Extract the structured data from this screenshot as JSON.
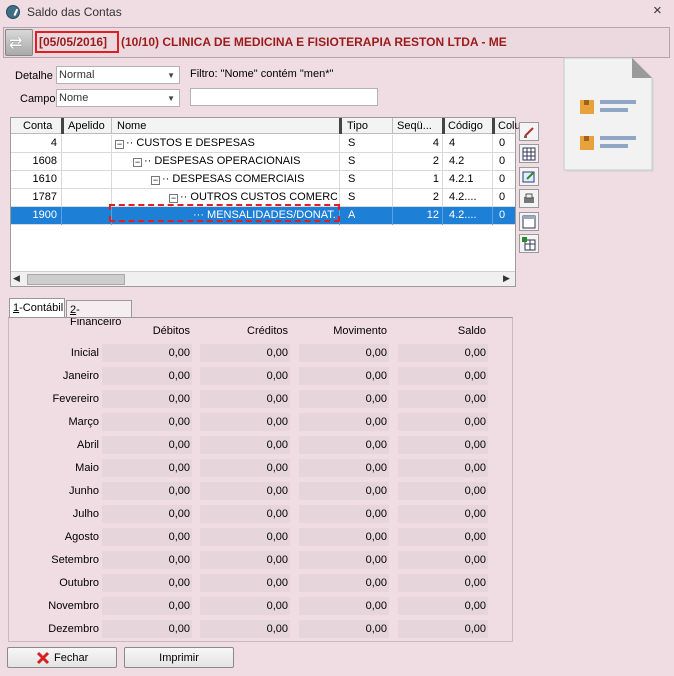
{
  "window": {
    "title": "Saldo das Contas",
    "close_glyph": "×"
  },
  "header": {
    "swap_icon": "swap-arrows-icon",
    "date": "[05/05/2016]",
    "company": "(10/10) CLINICA DE MEDICINA E FISIOTERAPIA RESTON LTDA - ME"
  },
  "filters": {
    "detalhe_label": "Detalhe",
    "detalhe_value": "Normal",
    "filtro_text": "Filtro: \"Nome\" contém \"men*\"",
    "campo_label": "Campo",
    "campo_value": "Nome",
    "search_value": ""
  },
  "grid": {
    "columns": [
      "Conta",
      "Apelido",
      "Nome",
      "Tipo",
      "Seqü...",
      "Código",
      "Colu"
    ],
    "rows": [
      {
        "conta": "4",
        "apelido": "",
        "nome": "CUSTOS E DESPESAS",
        "tipo": "S",
        "seq": "4",
        "codigo": "4",
        "col": "0"
      },
      {
        "conta": "1608",
        "apelido": "",
        "nome": "DESPESAS OPERACIONAIS",
        "tipo": "S",
        "seq": "2",
        "codigo": "4.2",
        "col": "0"
      },
      {
        "conta": "1610",
        "apelido": "",
        "nome": "DESPESAS COMERCIAIS",
        "tipo": "S",
        "seq": "1",
        "codigo": "4.2.1",
        "col": "0"
      },
      {
        "conta": "1787",
        "apelido": "",
        "nome": "OUTROS CUSTOS COMERC...",
        "tipo": "S",
        "seq": "2",
        "codigo": "4.2....",
        "col": "0"
      },
      {
        "conta": "1900",
        "apelido": "",
        "nome": "MENSALIDADES/DONAT...",
        "tipo": "A",
        "seq": "12",
        "codigo": "4.2....",
        "col": "0"
      }
    ]
  },
  "tabs": {
    "contabil_key": "1",
    "contabil": "-Contábil",
    "financeiro_key": "2",
    "financeiro": "-Financeiro"
  },
  "balances": {
    "headers": [
      "Débitos",
      "Créditos",
      "Movimento",
      "Saldo"
    ],
    "months": [
      {
        "name": "Inicial",
        "values": [
          "0,00",
          "0,00",
          "0,00",
          "0,00"
        ]
      },
      {
        "name": "Janeiro",
        "values": [
          "0,00",
          "0,00",
          "0,00",
          "0,00"
        ]
      },
      {
        "name": "Fevereiro",
        "values": [
          "0,00",
          "0,00",
          "0,00",
          "0,00"
        ]
      },
      {
        "name": "Março",
        "values": [
          "0,00",
          "0,00",
          "0,00",
          "0,00"
        ]
      },
      {
        "name": "Abril",
        "values": [
          "0,00",
          "0,00",
          "0,00",
          "0,00"
        ]
      },
      {
        "name": "Maio",
        "values": [
          "0,00",
          "0,00",
          "0,00",
          "0,00"
        ]
      },
      {
        "name": "Junho",
        "values": [
          "0,00",
          "0,00",
          "0,00",
          "0,00"
        ]
      },
      {
        "name": "Julho",
        "values": [
          "0,00",
          "0,00",
          "0,00",
          "0,00"
        ]
      },
      {
        "name": "Agosto",
        "values": [
          "0,00",
          "0,00",
          "0,00",
          "0,00"
        ]
      },
      {
        "name": "Setembro",
        "values": [
          "0,00",
          "0,00",
          "0,00",
          "0,00"
        ]
      },
      {
        "name": "Outubro",
        "values": [
          "0,00",
          "0,00",
          "0,00",
          "0,00"
        ]
      },
      {
        "name": "Novembro",
        "values": [
          "0,00",
          "0,00",
          "0,00",
          "0,00"
        ]
      },
      {
        "name": "Dezembro",
        "values": [
          "0,00",
          "0,00",
          "0,00",
          "0,00"
        ]
      }
    ]
  },
  "footer": {
    "fechar": "Fechar",
    "imprimir": "Imprimir"
  },
  "colors": {
    "title_red": "#9b1a1a",
    "highlight_red": "#e02020",
    "selection_blue": "#1e7fd6",
    "window_bg": "#f0dde3"
  }
}
